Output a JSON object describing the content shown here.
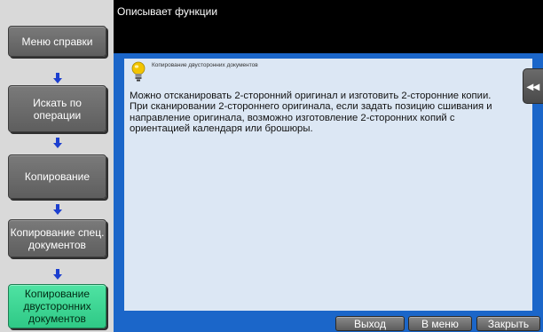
{
  "header": {
    "title": "Описывает функции"
  },
  "nav": {
    "items": [
      {
        "label": "Меню справки"
      },
      {
        "label": "Искать по операции"
      },
      {
        "label": "Копирование"
      },
      {
        "label": "Копирование спец. документов"
      },
      {
        "label": "Копирование двусторонних документов"
      }
    ],
    "active_index": 4
  },
  "content": {
    "topic_title": "Копирование двусторонних документов",
    "topic_icon": "lightbulb-icon",
    "description": "Можно отсканировать 2-сторонний оригинал и изготовить 2-сторонние копии. При сканировании 2-стороннего оригинала, если задать позицию сшивания и направление оригинала, возможно изготовление 2-сторонних копий с ориентацией календаря или брошюры."
  },
  "side_tab": {
    "icon": "collapse-left-icon",
    "glyph": "◂◂"
  },
  "buttons": {
    "exit": "Выход",
    "menu": "В меню",
    "close": "Закрыть"
  },
  "colors": {
    "frame_blue": "#1b66c9",
    "panel_bg": "#dce7f4",
    "active_green": "#2fc986",
    "arrow_blue": "#1c3fcf"
  }
}
